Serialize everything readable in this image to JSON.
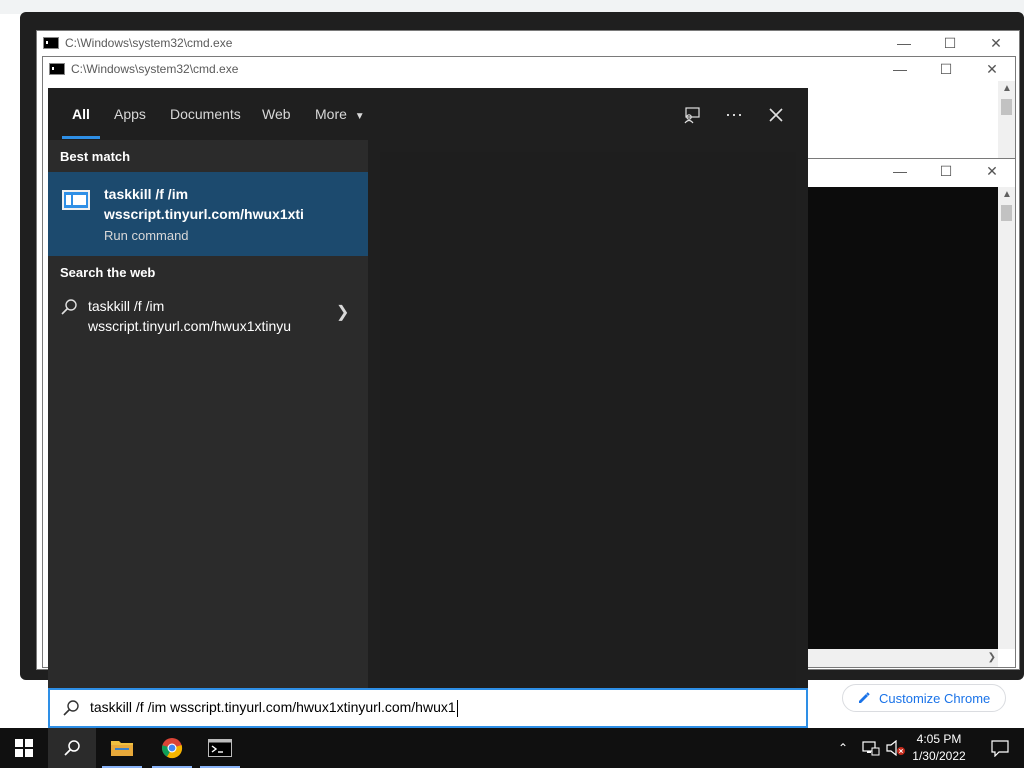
{
  "background": {
    "customize_chrome_label": "Customize Chrome"
  },
  "cmd_windows": [
    {
      "title": "C:\\Windows\\system32\\cmd.exe"
    },
    {
      "title": "C:\\Windows\\system32\\cmd.exe"
    }
  ],
  "search_panel": {
    "tabs": [
      {
        "label": "All",
        "active": true
      },
      {
        "label": "Apps"
      },
      {
        "label": "Documents"
      },
      {
        "label": "Web"
      },
      {
        "label": "More"
      }
    ],
    "best_match_heading": "Best match",
    "best_match": {
      "title_line1": "taskkill /f /im",
      "title_line2": "wsscript.tinyurl.com/hwux1xti",
      "subtitle": "Run command"
    },
    "search_web_heading": "Search the web",
    "web_result": {
      "line1": "taskkill /f /im",
      "line2": "wsscript.tinyurl.com/hwux1xtinyu"
    }
  },
  "search_box": {
    "value": "taskkill /f /im wsscript.tinyurl.com/hwux1xtinyurl.com/hwux1"
  },
  "taskbar": {
    "time": "4:05 PM",
    "date": "1/30/2022"
  },
  "colors": {
    "accent": "#2e8fe6",
    "best_match_bg": "#1c4a6e",
    "panel_bg": "#2b2b2b",
    "taskbar_bg": "#101010"
  }
}
